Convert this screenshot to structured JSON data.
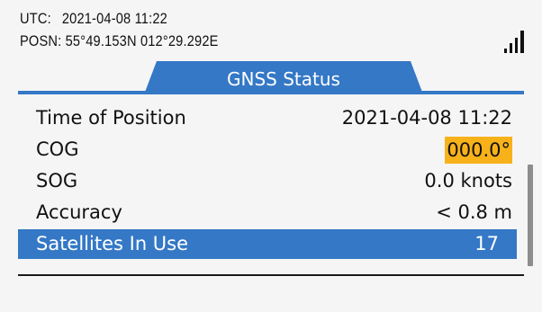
{
  "header": {
    "utc_label": "UTC:",
    "utc_value": "2021-04-08  11:22",
    "posn_label": "POSN:",
    "posn_value": "55°49.153N  012°29.292E",
    "signal_icon": "signal-strength-icon"
  },
  "tab": {
    "title": "GNSS Status"
  },
  "rows": [
    {
      "label": "Time of Position",
      "value": "2021-04-08 11:22"
    },
    {
      "label": "COG",
      "value": "000.0°"
    },
    {
      "label": "SOG",
      "value": "0.0 knots"
    },
    {
      "label": "Accuracy",
      "value": "< 0.8 m"
    },
    {
      "label": "Satellites In Use",
      "value": "17"
    }
  ],
  "colors": {
    "accent": "#3478c6",
    "highlight": "#f7b21a",
    "background": "#f5f5f5",
    "scrollbar": "#8d8d8d"
  }
}
